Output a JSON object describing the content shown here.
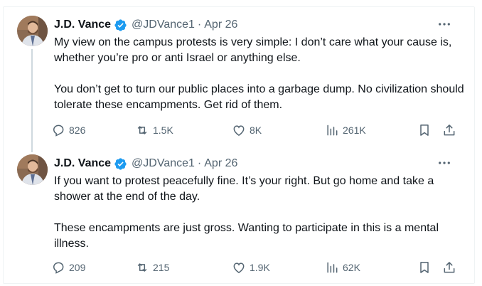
{
  "tweets": [
    {
      "author": {
        "name": "J.D. Vance",
        "handle": "@JDVance1",
        "date": "Apr 26",
        "verified": true
      },
      "paragraphs": [
        "My view on the campus protests is very simple: I don’t care what your cause is, whether you’re pro or anti Israel or anything else.",
        "You don’t get to turn our public places into a garbage dump. No civilization should tolerate these encampments.  Get rid of them."
      ],
      "stats": {
        "replies": "826",
        "reposts": "1.5K",
        "likes": "8K",
        "views": "261K"
      }
    },
    {
      "author": {
        "name": "J.D. Vance",
        "handle": "@JDVance1",
        "date": "Apr 26",
        "verified": true
      },
      "paragraphs": [
        "If you want to protest peacefully fine. It’s your right. But go home and take a shower at the end of the day.",
        "These encampments are just gross. Wanting to participate in this is a mental illness."
      ],
      "stats": {
        "replies": "209",
        "reposts": "215",
        "likes": "1.9K",
        "views": "62K"
      }
    }
  ],
  "separator": "·",
  "colors": {
    "text": "#0f1419",
    "secondary": "#536471",
    "verified": "#1d9bf0",
    "thread_line": "#cfd9de",
    "border": "#eff3f4"
  },
  "icons": [
    "avatar",
    "verified-badge-icon",
    "more-icon",
    "reply-icon",
    "repost-icon",
    "like-icon",
    "views-icon",
    "bookmark-icon",
    "share-icon"
  ]
}
